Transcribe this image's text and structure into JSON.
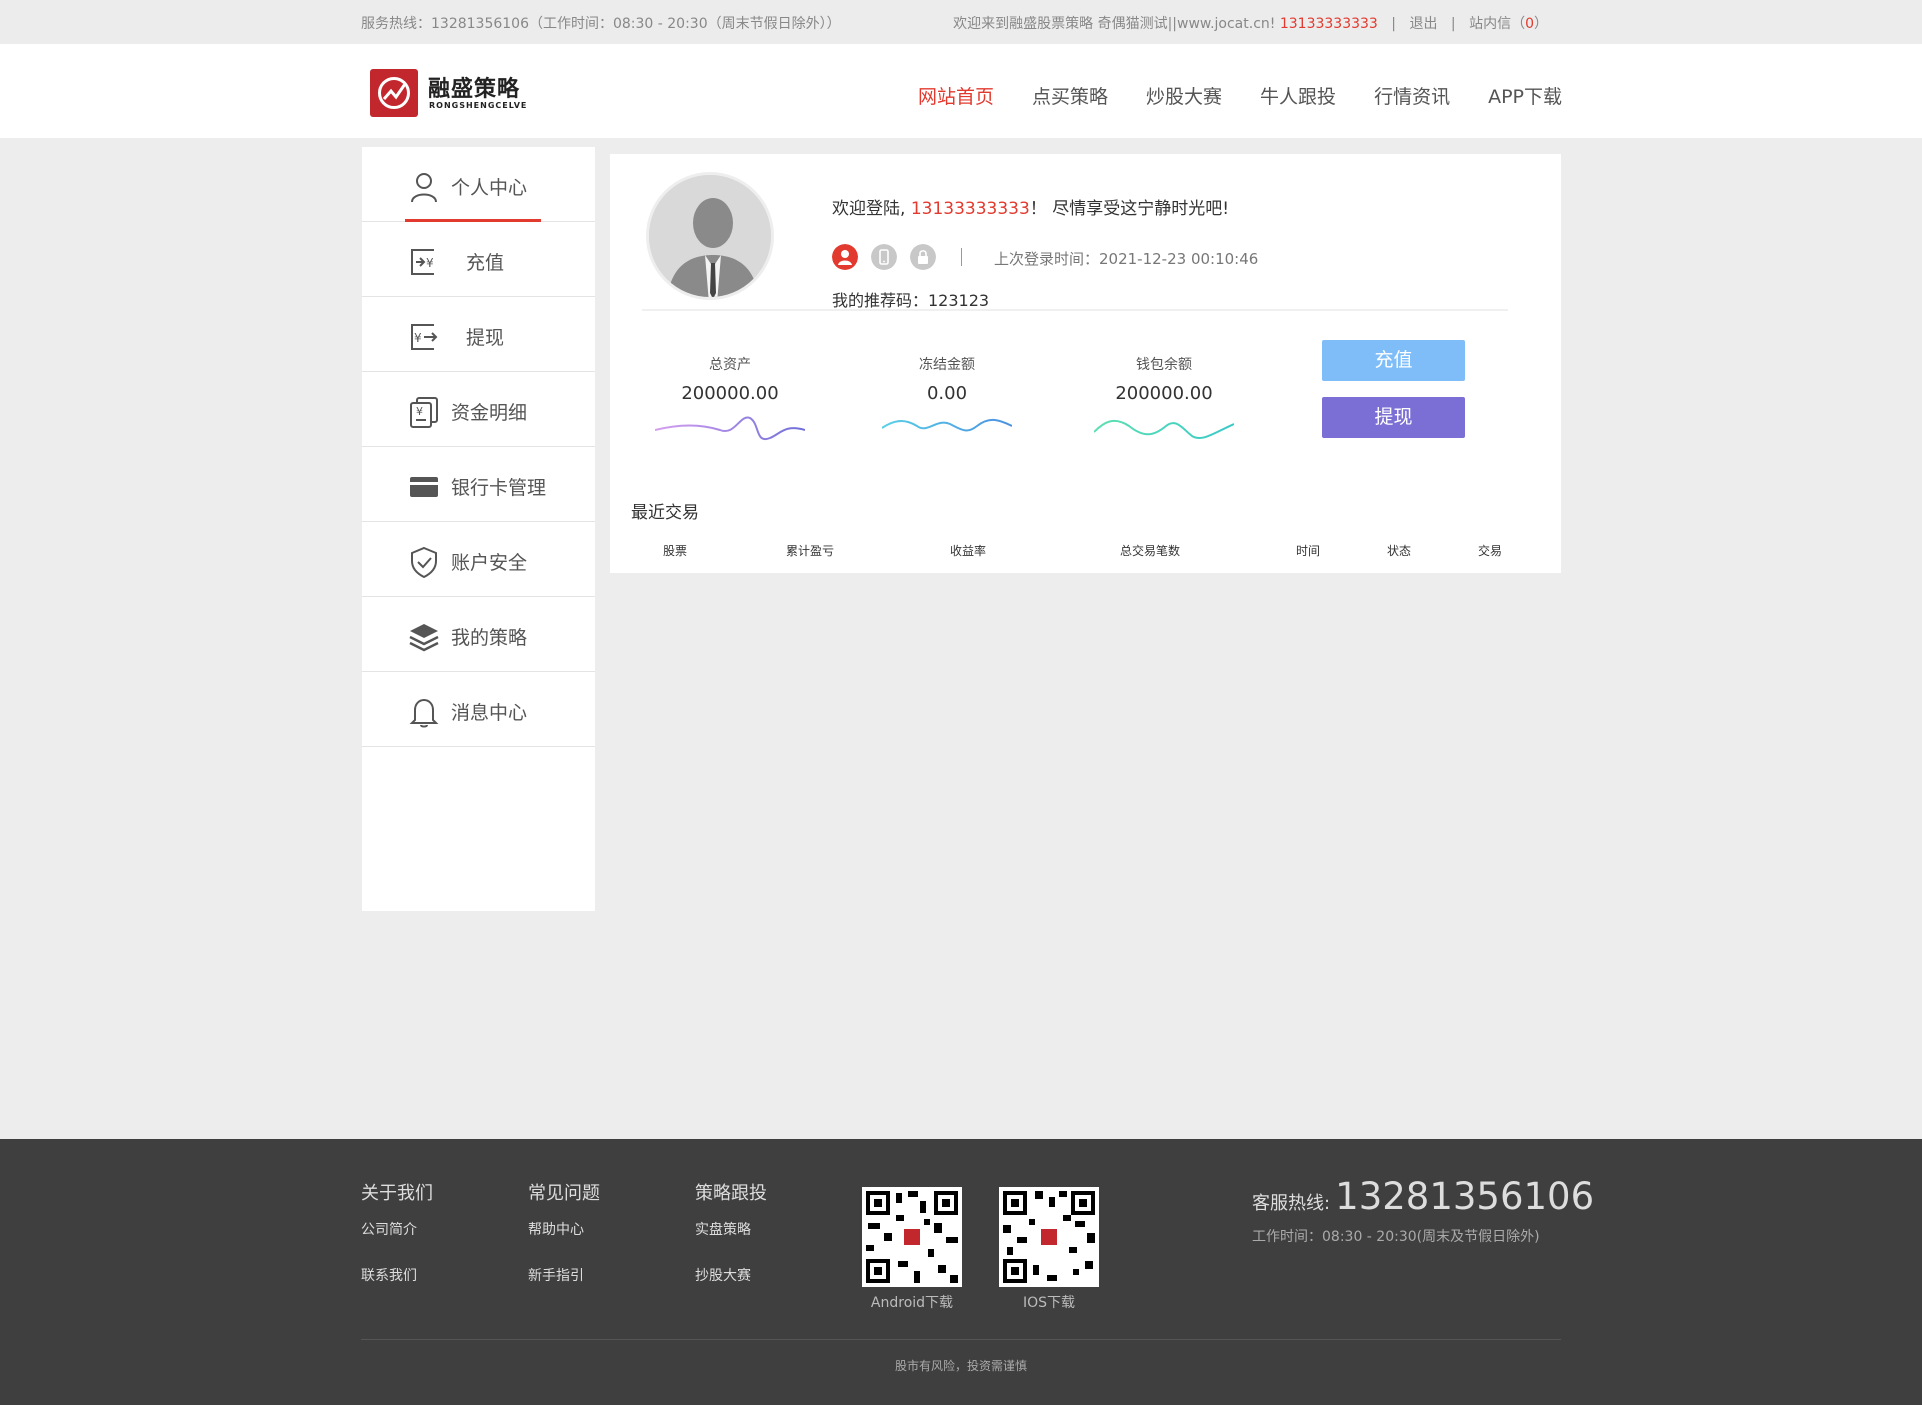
{
  "topbar": {
    "hotline_text": "服务热线：13281356106（工作时间：08:30 - 20:30（周末节假日除外））",
    "welcome_text": "欢迎来到融盛股票策略 奇偶猫测试||www.jocat.cn!",
    "account": "13133333333",
    "logout": "退出",
    "inbox_label": "站内信（",
    "inbox_count": "0",
    "inbox_close": "）"
  },
  "header": {
    "logo_cn": "融盛策略",
    "logo_en": "RONGSHENGCELVE",
    "nav": [
      "网站首页",
      "点买策略",
      "炒股大赛",
      "牛人跟投",
      "行情资讯",
      "APP下载"
    ]
  },
  "sidebar": {
    "items": [
      {
        "label": "个人中心",
        "icon": "user-icon"
      },
      {
        "label": "充值",
        "icon": "recharge-icon"
      },
      {
        "label": "提现",
        "icon": "withdraw-icon"
      },
      {
        "label": "资金明细",
        "icon": "fund-detail-icon"
      },
      {
        "label": "银行卡管理",
        "icon": "bank-card-icon"
      },
      {
        "label": "账户安全",
        "icon": "shield-icon"
      },
      {
        "label": "我的策略",
        "icon": "layers-icon"
      },
      {
        "label": "消息中心",
        "icon": "bell-icon"
      }
    ]
  },
  "profile": {
    "welcome_prefix": "欢迎登陆, ",
    "account": "13133333333",
    "welcome_suffix": "！ 尽情享受这宁静时光吧!",
    "last_login": "上次登录时间：2021-12-23 00:10:46",
    "referral": "我的推荐码：123123",
    "status_colors": {
      "user_verified": "#e23a2e",
      "phone": "#c8c8c8",
      "password": "#c8c8c8"
    }
  },
  "stats": [
    {
      "label": "总资产",
      "value": "200000.00",
      "wave_from": "#d49ff0",
      "wave_to": "#6f6fd8"
    },
    {
      "label": "冻结金额",
      "value": "0.00",
      "wave_from": "#5ad0e6",
      "wave_to": "#4a90e2"
    },
    {
      "label": "钱包余额",
      "value": "200000.00",
      "wave_from": "#5fe0b0",
      "wave_to": "#36c9c9"
    }
  ],
  "actions": {
    "recharge": "充值",
    "withdraw": "提现"
  },
  "recent": {
    "title": "最近交易",
    "columns": [
      "股票",
      "累计盈亏",
      "收益率",
      "总交易笔数",
      "时间",
      "状态",
      "交易"
    ]
  },
  "footer": {
    "cols": [
      {
        "title": "关于我们",
        "links": [
          "公司简介",
          "联系我们"
        ]
      },
      {
        "title": "常见问题",
        "links": [
          "帮助中心",
          "新手指引"
        ]
      },
      {
        "title": "策略跟投",
        "links": [
          "实盘策略",
          "抄股大赛"
        ]
      }
    ],
    "qr": [
      "Android下载",
      "IOS下载"
    ],
    "hotline_label": "客服热线:",
    "hotline": "13281356106",
    "hours": "工作时间：08:30 - 20:30(周末及节假日除外)",
    "risk": "股市有风险，投资需谨慎"
  },
  "colors": {
    "accent": "#e23a2e",
    "brand": "#c1272d",
    "recharge_btn": "#7fbdf9",
    "withdraw_btn": "#7b6fd6"
  }
}
